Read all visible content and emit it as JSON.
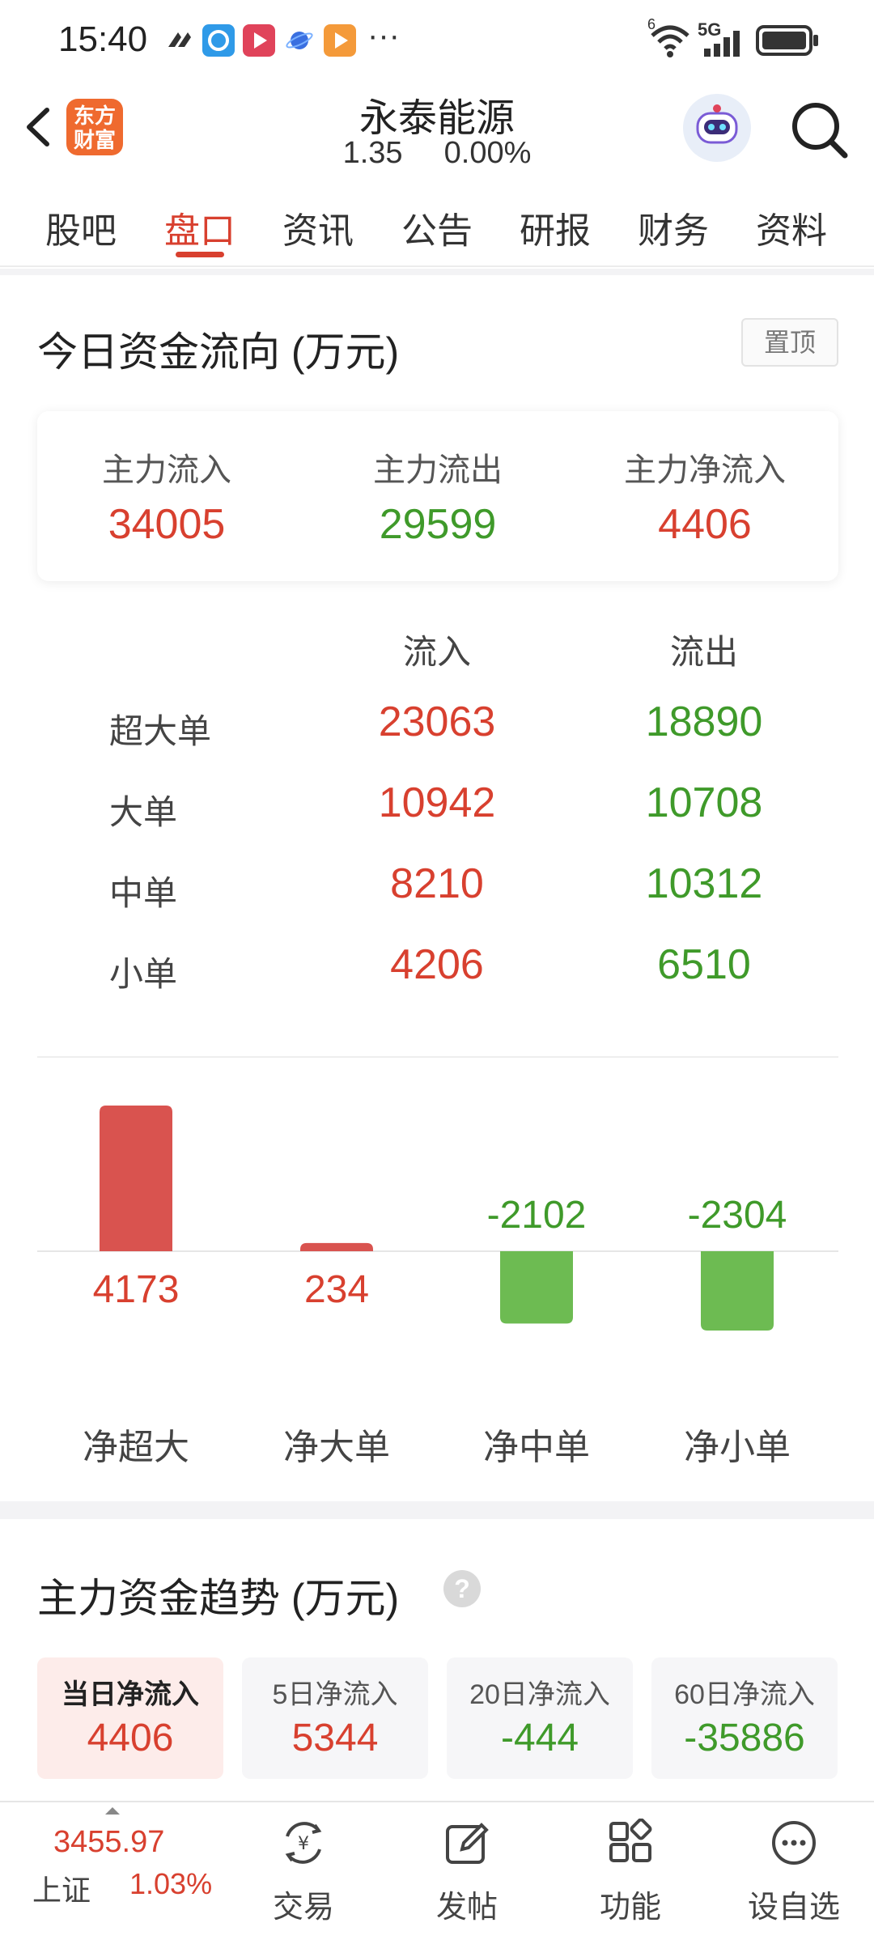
{
  "status_bar": {
    "time": "15:40",
    "more": "···",
    "network": "5G",
    "wifi_badge": "6"
  },
  "header": {
    "logo_text": "东方财富",
    "stock_name": "永泰能源",
    "price": "1.35",
    "change": "0.00%"
  },
  "tabs": [
    {
      "label": "股吧"
    },
    {
      "label": "盘口"
    },
    {
      "label": "资讯"
    },
    {
      "label": "公告"
    },
    {
      "label": "研报"
    },
    {
      "label": "财务"
    },
    {
      "label": "资料"
    }
  ],
  "capital_flow": {
    "title": "今日资金流向 (万元)",
    "pin_label": "置顶",
    "summary": [
      {
        "label": "主力流入",
        "value": "34005",
        "color": "#d8402f"
      },
      {
        "label": "主力流出",
        "value": "29599",
        "color": "#3f9a2a"
      },
      {
        "label": "主力净流入",
        "value": "4406",
        "color": "#d8402f"
      }
    ],
    "table": {
      "headers": [
        "流入",
        "流出"
      ],
      "rows": [
        {
          "label": "超大单",
          "in": "23063",
          "out": "18890"
        },
        {
          "label": "大单",
          "in": "10942",
          "out": "10708"
        },
        {
          "label": "中单",
          "in": "8210",
          "out": "10312"
        },
        {
          "label": "小单",
          "in": "4206",
          "out": "6510"
        }
      ]
    }
  },
  "chart_data": {
    "type": "bar",
    "categories": [
      "净超大",
      "净大单",
      "净中单",
      "净小单"
    ],
    "values": [
      4173,
      234,
      -2102,
      -2304
    ],
    "positive_color": "#d9534f",
    "negative_color": "#6dbb52"
  },
  "trend": {
    "title": "主力资金趋势 (万元)",
    "help_icon": "?",
    "cards": [
      {
        "label": "当日净流入",
        "value": "4406",
        "color": "#d8402f"
      },
      {
        "label": "5日净流入",
        "value": "5344",
        "color": "#d8402f"
      },
      {
        "label": "20日净流入",
        "value": "-444",
        "color": "#3f9a2a"
      },
      {
        "label": "60日净流入",
        "value": "-35886",
        "color": "#3f9a2a"
      }
    ]
  },
  "bottom_nav": {
    "index_value": "3455.97",
    "index_name": "上证",
    "index_change": "1.03%",
    "items": [
      {
        "label": "交易",
        "icon": "yen-exchange-icon"
      },
      {
        "label": "发帖",
        "icon": "edit-post-icon"
      },
      {
        "label": "功能",
        "icon": "grid-apps-icon"
      },
      {
        "label": "设自选",
        "icon": "more-dots-icon"
      }
    ]
  }
}
